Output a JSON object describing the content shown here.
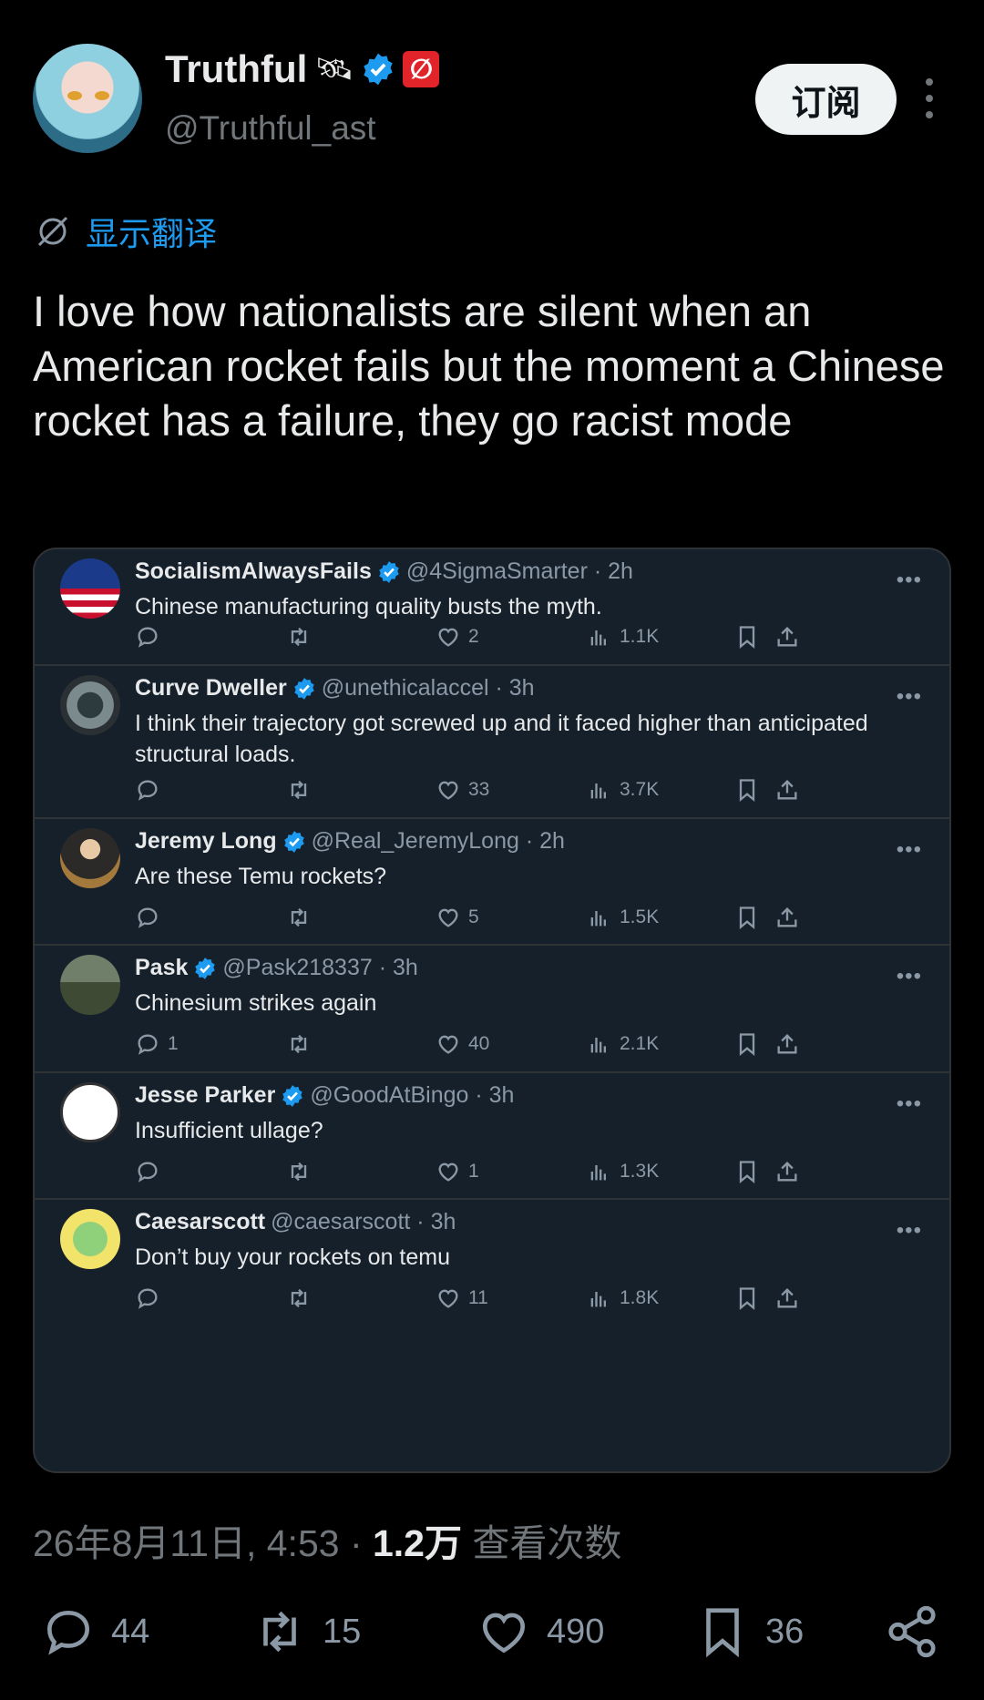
{
  "author": {
    "name": "Truthful",
    "emoji": "🛰",
    "flag_glyph": "∅",
    "handle": "@Truthful_ast"
  },
  "subscribe_label": "订阅",
  "translate_label": "显示翻译",
  "tweet_text": "I love how nationalists are silent when an American rocket fails but the moment a Chinese rocket has a failure, they go racist mode",
  "replies": [
    {
      "name": "SocialismAlwaysFails",
      "handle": "@4SigmaSmarter · 2h",
      "text": "Chinese manufacturing quality busts the myth.",
      "comments": "",
      "likes": "2",
      "views": "1.1K",
      "verified": true
    },
    {
      "name": "Curve Dweller",
      "handle": "@unethicalaccel · 3h",
      "text": "I think their trajectory got screwed up and it faced higher than anticipated structural loads.",
      "comments": "",
      "likes": "33",
      "views": "3.7K",
      "verified": true
    },
    {
      "name": "Jeremy Long",
      "handle": "@Real_JeremyLong · 2h",
      "text": "Are these Temu rockets?",
      "comments": "",
      "likes": "5",
      "views": "1.5K",
      "verified": true
    },
    {
      "name": "Pask",
      "handle": "@Pask218337 · 3h",
      "text": "Chinesium strikes again",
      "comments": "1",
      "likes": "40",
      "views": "2.1K",
      "verified": true
    },
    {
      "name": "Jesse Parker",
      "handle": "@GoodAtBingo · 3h",
      "text": "Insufficient ullage?",
      "comments": "",
      "likes": "1",
      "views": "1.3K",
      "verified": true
    },
    {
      "name": "Caesarscott",
      "handle": "@caesarscott · 3h",
      "text": "Don’t buy your rockets on temu",
      "comments": "",
      "likes": "11",
      "views": "1.8K",
      "verified": false
    }
  ],
  "meta": {
    "datetime": "26年8月11日, 4:53 · ",
    "views_count": "1.2万",
    "views_label": " 查看次数"
  },
  "stats": {
    "replies": "44",
    "reposts": "15",
    "likes": "490",
    "bookmarks": "36"
  },
  "colors": {
    "accent": "#1d9bf0",
    "background": "#000000",
    "card": "#15202b"
  }
}
